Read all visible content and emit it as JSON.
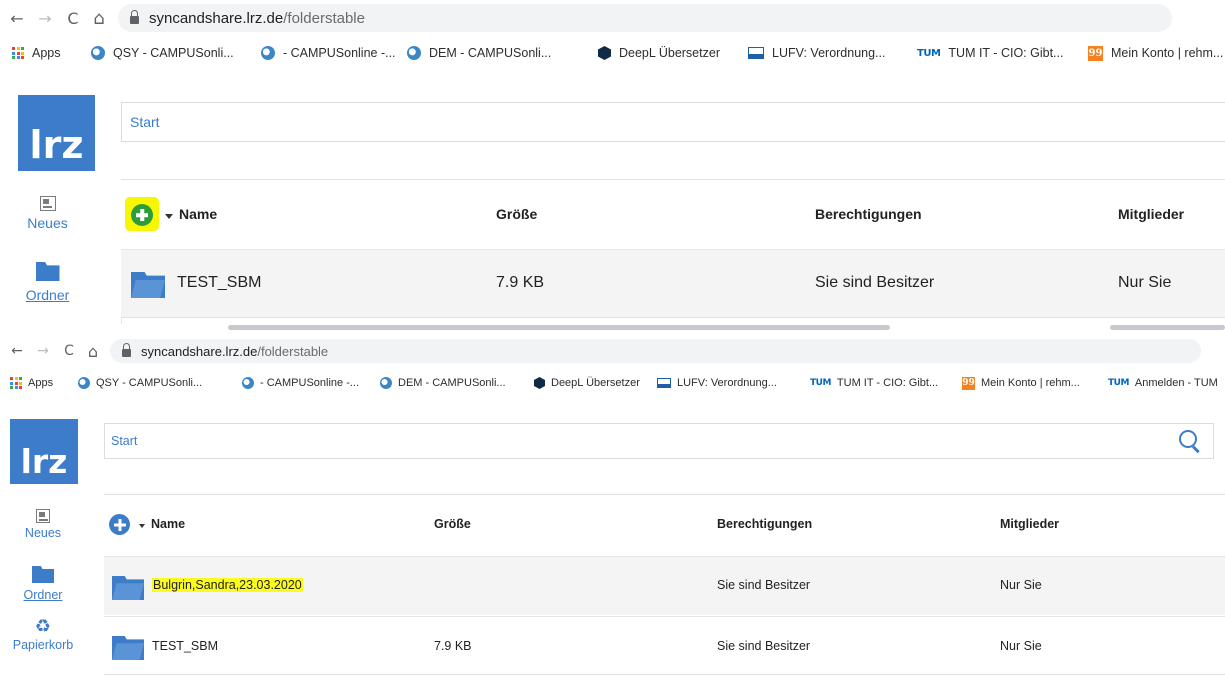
{
  "browser": {
    "back": "←",
    "forward": "→",
    "reload": "C",
    "home": "⌂",
    "url_host": "syncandshare.lrz.de",
    "url_path": "/folderstable"
  },
  "bookmarks_1": [
    "Apps",
    "QSY - CAMPUSonli...",
    "- CAMPUSonline -...",
    "DEM - CAMPUSonli...",
    "DeepL Übersetzer",
    "LUFV: Verordnung...",
    "TUM IT - CIO: Gibt...",
    "Mein Konto | rehm..."
  ],
  "bookmarks_2": [
    "Apps",
    "QSY - CAMPUSonli...",
    "- CAMPUSonline -...",
    "DEM - CAMPUSonli...",
    "DeepL Übersetzer",
    "LUFV: Verordnung...",
    "TUM IT - CIO: Gibt...",
    "Mein Konto | rehm...",
    "Anmelden - TUM"
  ],
  "bookmark_icons": [
    "apps-icon",
    "campusonline-icon",
    "campusonline-icon",
    "campusonline-icon",
    "deepl-icon",
    "lufv-icon",
    "tum-icon",
    "mein-konto-icon",
    "tum-icon"
  ],
  "tum_glyph": "TUM",
  "q_glyph": "99",
  "logo_text": "lrz",
  "sidebar": {
    "news": "Neues",
    "folders": "Ordner",
    "trash": "Papierkorb"
  },
  "search": {
    "placeholder": "Start"
  },
  "table": {
    "name": "Name",
    "size": "Größe",
    "permissions": "Berechtigungen",
    "members": "Mitglieder"
  },
  "rows_before": [
    {
      "name": "TEST_SBM",
      "size": "7.9 KB",
      "permissions": "Sie sind Besitzer",
      "members": "Nur Sie"
    }
  ],
  "rows_after": [
    {
      "name": "Bulgrin,Sandra,23.03.2020",
      "size": "",
      "permissions": "Sie sind Besitzer",
      "members": "Nur Sie",
      "highlighted": true
    },
    {
      "name": "TEST_SBM",
      "size": "7.9 KB",
      "permissions": "Sie sind Besitzer",
      "members": "Nur Sie"
    }
  ],
  "colors": {
    "accent": "#3d7cc9",
    "highlight": "#f6f700",
    "add_button_highlighted": "#2e9d38"
  }
}
